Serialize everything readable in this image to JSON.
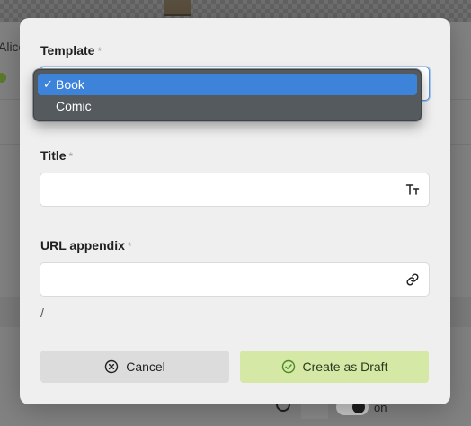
{
  "background": {
    "user_name": "Alice",
    "toggle_label": "on"
  },
  "modal": {
    "template": {
      "label": "Template",
      "required_mark": "*",
      "options": [
        {
          "label": "Book",
          "selected": true
        },
        {
          "label": "Comic",
          "selected": false
        }
      ],
      "check_mark": "✓"
    },
    "title": {
      "label": "Title",
      "required_mark": "*",
      "value": "",
      "icon": "text-size-icon"
    },
    "url_appendix": {
      "label": "URL appendix",
      "required_mark": "*",
      "value": "",
      "icon": "link-icon",
      "prefix": "/"
    },
    "buttons": {
      "cancel": {
        "label": "Cancel",
        "icon": "cancel-circle-icon"
      },
      "create": {
        "label": "Create as Draft",
        "icon": "check-circle-icon"
      }
    }
  },
  "colors": {
    "selected_option": "#3d83d9",
    "create_button": "#d5e8a6",
    "cancel_button": "#dcdcdc"
  }
}
